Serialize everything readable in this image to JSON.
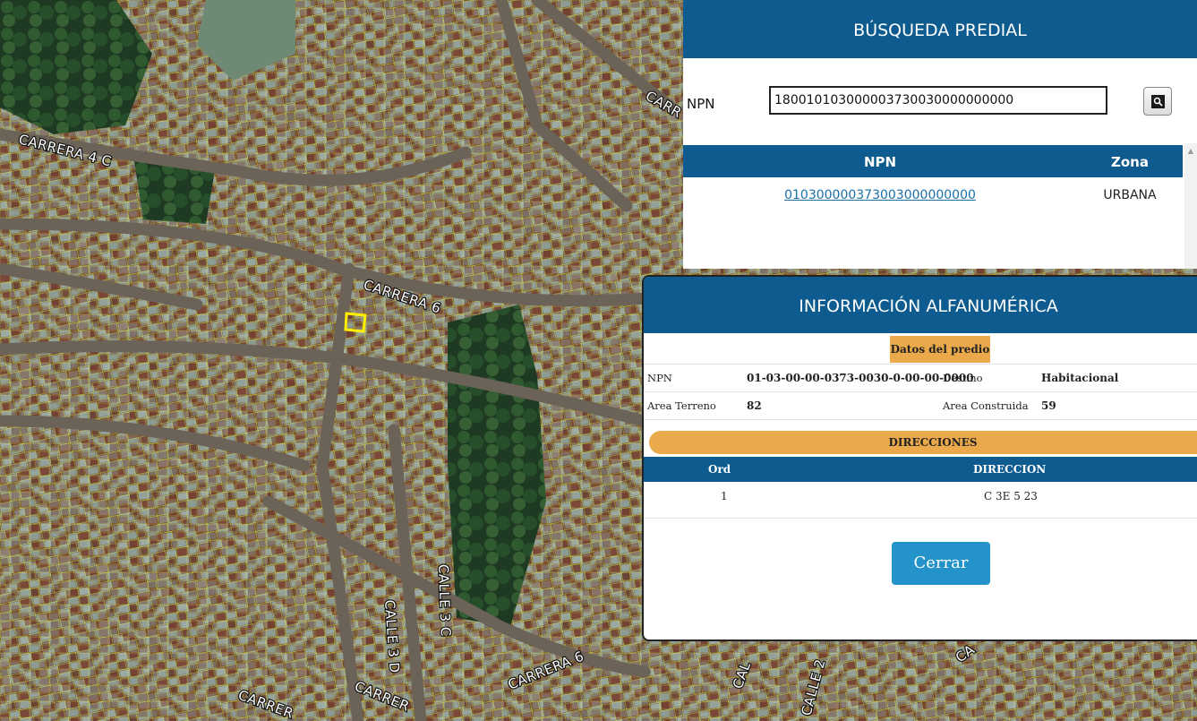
{
  "map": {
    "street_labels": [
      {
        "id": "carrera-4c",
        "text": "CARRERA 4 C"
      },
      {
        "id": "carrera-6-upper",
        "text": "CARRERA 6"
      },
      {
        "id": "carr-top",
        "text": "CARR"
      },
      {
        "id": "carrera-6-lower",
        "text": "CARRERA 6"
      },
      {
        "id": "calle-3c",
        "text": "CALLE 3 C"
      },
      {
        "id": "calle-3d",
        "text": "CALLE 3 D"
      },
      {
        "id": "carrer-bottom",
        "text": "CARRER"
      },
      {
        "id": "carrer-bottom-2",
        "text": "CARRER"
      },
      {
        "id": "cal-bottom",
        "text": "CAL"
      },
      {
        "id": "calle-2-bottom",
        "text": "CALLE 2"
      },
      {
        "id": "ca-bottom",
        "text": "CA"
      }
    ],
    "colors": {
      "parcel_line": "#e8e84a",
      "selected_parcel": "#ffee00"
    }
  },
  "search_panel": {
    "title": "BÚSQUEDA PREDIAL",
    "npn_label": "NPN",
    "npn_value": "180010103000003730030000000000",
    "results": {
      "headers": {
        "npn": "NPN",
        "zona": "Zona"
      },
      "rows": [
        {
          "npn": "010300000373003000000000",
          "zona": "URBANA"
        }
      ]
    }
  },
  "info_dialog": {
    "title": "INFORMACIÓN ALFANUMÉRICA",
    "datos_label": "Datos del predio",
    "fields": {
      "npn_label": "NPN",
      "npn_value": "01-03-00-00-0373-0030-0-00-00-0000",
      "destino_label": "Destino",
      "destino_value": "Habitacional",
      "area_terreno_label": "Area Terreno",
      "area_terreno_value": "82",
      "area_construida_label": "Area Construida",
      "area_construida_value": "59"
    },
    "direcciones_label": "DIRECCIONES",
    "direcciones": {
      "headers": {
        "ord": "Ord",
        "direccion": "DIRECCION"
      },
      "rows": [
        {
          "ord": "1",
          "direccion": "C 3E 5 23"
        }
      ]
    },
    "close_label": "Cerrar"
  },
  "colors": {
    "header_blue": "#0e5c8f",
    "accent_orange": "#eaa94a",
    "button_blue": "#2393c9",
    "link_blue": "#1a6fa8"
  }
}
